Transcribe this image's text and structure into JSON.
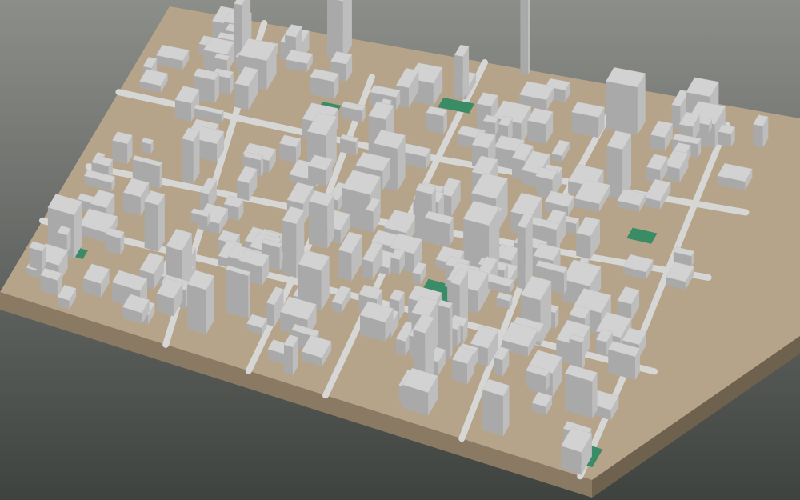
{
  "scene": {
    "colors": {
      "background_top": "#8c8e8a",
      "background_bottom": "#3f433f",
      "ground": "#b6a48a",
      "base_side_front": "#8a7a63",
      "base_side_right": "#6e614e",
      "road": "#d6d6d4",
      "building_top": "#d2d2d2",
      "building_left": "#a9a9a9",
      "building_right": "#bdbdbd",
      "park": "#3a8c66"
    }
  }
}
